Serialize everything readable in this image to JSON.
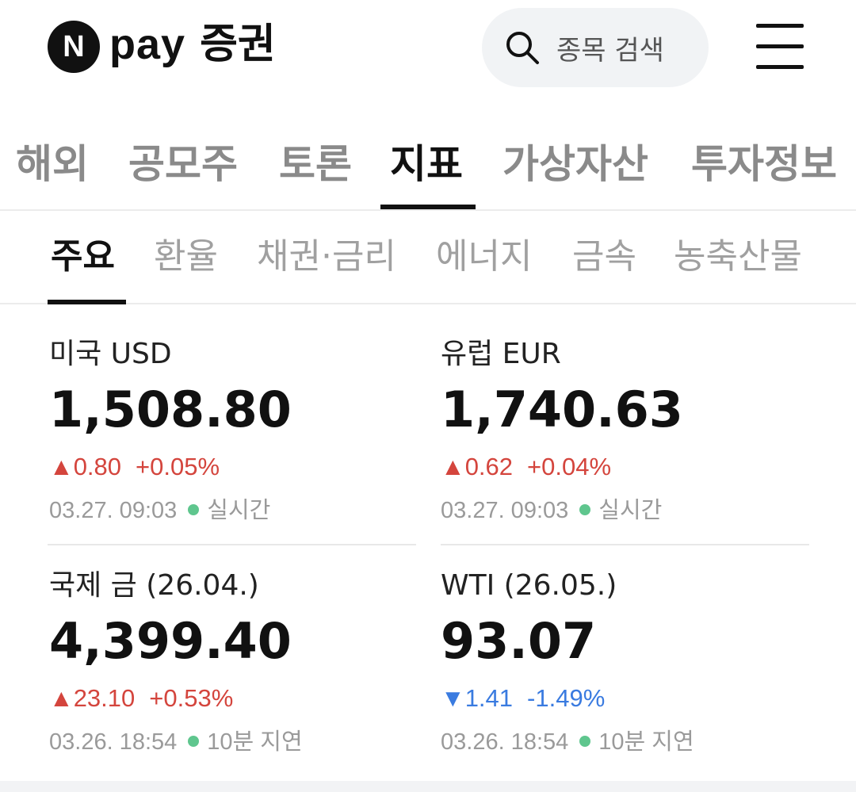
{
  "header": {
    "logo_n": "N",
    "logo_pay": "pay",
    "logo_sec": "증권",
    "search_placeholder": "종목 검색"
  },
  "tabs": [
    {
      "label": "해외"
    },
    {
      "label": "공모주"
    },
    {
      "label": "토론"
    },
    {
      "label": "지표",
      "active": true
    },
    {
      "label": "가상자산"
    },
    {
      "label": "투자정보"
    }
  ],
  "subtabs": [
    {
      "label": "주요",
      "active": true
    },
    {
      "label": "환율"
    },
    {
      "label": "채권·금리"
    },
    {
      "label": "에너지"
    },
    {
      "label": "금속"
    },
    {
      "label": "농축산물"
    }
  ],
  "cards": [
    {
      "name": "미국 USD",
      "value": "1,508.80",
      "arrow": "▲",
      "change": "0.80",
      "percent": "+0.05%",
      "direction": "up",
      "time": "03.27. 09:03",
      "status": "실시간"
    },
    {
      "name": "유럽 EUR",
      "value": "1,740.63",
      "arrow": "▲",
      "change": "0.62",
      "percent": "+0.04%",
      "direction": "up",
      "time": "03.27. 09:03",
      "status": "실시간"
    },
    {
      "name": "국제 금 (26.04.)",
      "value": "4,399.40",
      "arrow": "▲",
      "change": "23.10",
      "percent": "+0.53%",
      "direction": "up",
      "time": "03.26. 18:54",
      "status": "10분 지연"
    },
    {
      "name": "WTI (26.05.)",
      "value": "93.07",
      "arrow": "▼",
      "change": "1.41",
      "percent": "-1.49%",
      "direction": "down",
      "time": "03.26. 18:54",
      "status": "10분 지연"
    }
  ],
  "colors": {
    "up": "#d4453d",
    "down": "#3a7be0",
    "status_dot": "#5fc68e"
  }
}
